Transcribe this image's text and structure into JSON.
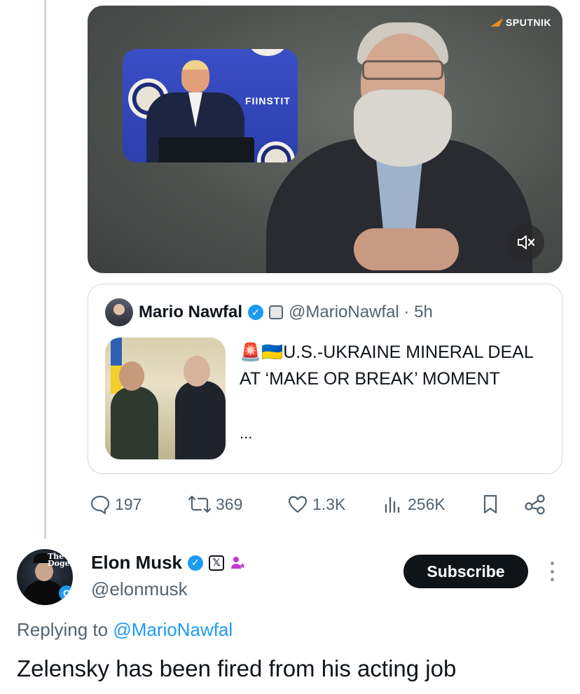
{
  "video": {
    "watermark": "SPUTNIK",
    "inset_sign": "FII NSTITUTE",
    "inset_sign_short": "FIINSTIT",
    "mute_icon": "mute-icon"
  },
  "quote": {
    "author_name": "Mario Nawfal",
    "handle_time": "@MarioNawfal · 5h",
    "text": "🚨🇺🇦U.S.-UKRAINE MINERAL DEAL AT ‘MAKE OR BREAK’ MOMENT",
    "ellipsis": "..."
  },
  "actions": {
    "replies": "197",
    "reposts": "369",
    "likes": "1.3K",
    "views": "256K"
  },
  "reply": {
    "name": "Elon Musk",
    "handle": "@elonmusk",
    "subscribe_label": "Subscribe",
    "replying_prefix": "Replying to ",
    "replying_to": "@MarioNawfal",
    "text": "Zelensky has been fired from his acting job",
    "avatar_overlay": "The Dogefa",
    "avatar_badge": "C"
  },
  "colors": {
    "accent": "#1d9bf0",
    "text_primary": "#0f1419",
    "text_secondary": "#536471",
    "border": "#cfd9de",
    "button_dark": "#0f1419"
  }
}
